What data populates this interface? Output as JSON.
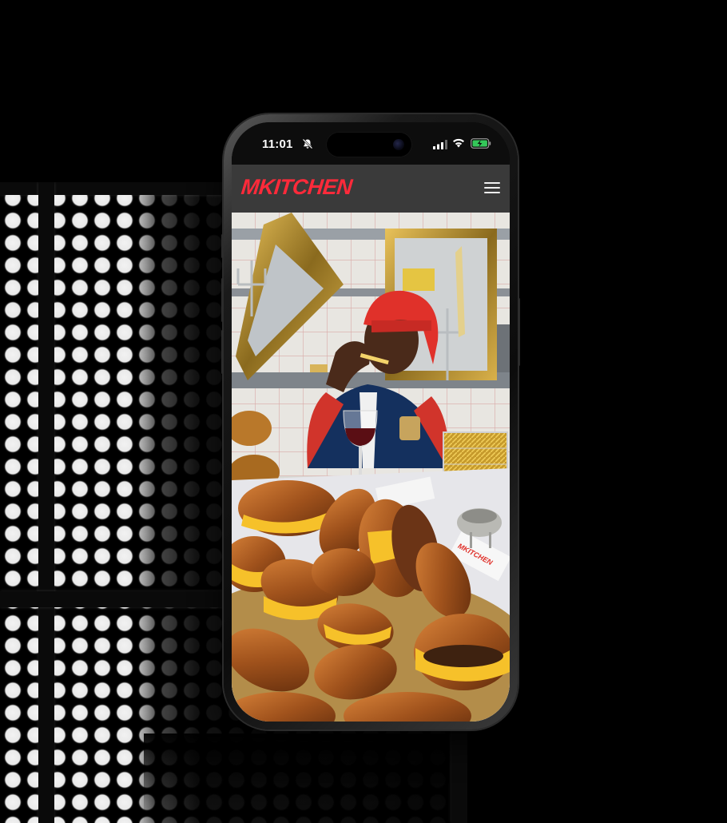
{
  "status_bar": {
    "time": "11:01",
    "icons": [
      "bell-slash-icon",
      "signal-icon",
      "wifi-icon",
      "battery-charging-icon"
    ]
  },
  "nav": {
    "brand": "MKITCHEN",
    "menu_icon": "hamburger-menu-icon"
  },
  "hero": {
    "napkin_text": "MKITCHEN"
  },
  "colors": {
    "brand_red": "#ff2a3a",
    "navbar_bg": "#3a3a3a",
    "page_bg": "#000000"
  }
}
